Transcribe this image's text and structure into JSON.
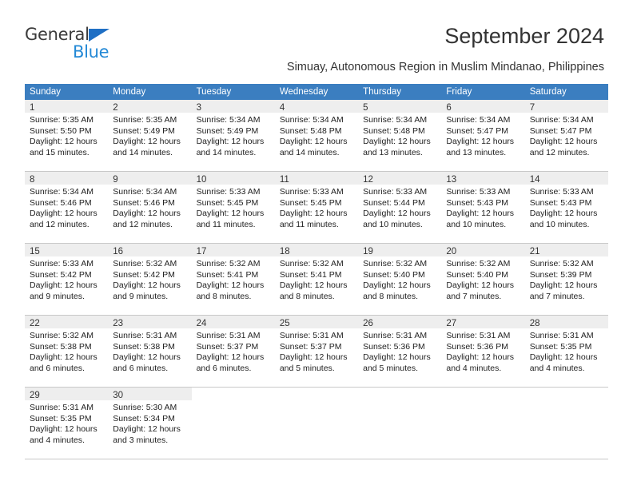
{
  "brand": {
    "name_part1": "General",
    "name_part2": "Blue",
    "accent_color": "#2489d6",
    "triangle_color": "#1f6fc4"
  },
  "header": {
    "title": "September 2024",
    "subtitle": "Simuay, Autonomous Region in Muslim Mindanao, Philippines"
  },
  "calendar": {
    "header_background": "#3b7ec0",
    "weekdays": [
      "Sunday",
      "Monday",
      "Tuesday",
      "Wednesday",
      "Thursday",
      "Friday",
      "Saturday"
    ],
    "weeks": [
      [
        {
          "day": "1",
          "sunrise": "Sunrise: 5:35 AM",
          "sunset": "Sunset: 5:50 PM",
          "daylight_line1": "Daylight: 12 hours",
          "daylight_line2": "and 15 minutes."
        },
        {
          "day": "2",
          "sunrise": "Sunrise: 5:35 AM",
          "sunset": "Sunset: 5:49 PM",
          "daylight_line1": "Daylight: 12 hours",
          "daylight_line2": "and 14 minutes."
        },
        {
          "day": "3",
          "sunrise": "Sunrise: 5:34 AM",
          "sunset": "Sunset: 5:49 PM",
          "daylight_line1": "Daylight: 12 hours",
          "daylight_line2": "and 14 minutes."
        },
        {
          "day": "4",
          "sunrise": "Sunrise: 5:34 AM",
          "sunset": "Sunset: 5:48 PM",
          "daylight_line1": "Daylight: 12 hours",
          "daylight_line2": "and 14 minutes."
        },
        {
          "day": "5",
          "sunrise": "Sunrise: 5:34 AM",
          "sunset": "Sunset: 5:48 PM",
          "daylight_line1": "Daylight: 12 hours",
          "daylight_line2": "and 13 minutes."
        },
        {
          "day": "6",
          "sunrise": "Sunrise: 5:34 AM",
          "sunset": "Sunset: 5:47 PM",
          "daylight_line1": "Daylight: 12 hours",
          "daylight_line2": "and 13 minutes."
        },
        {
          "day": "7",
          "sunrise": "Sunrise: 5:34 AM",
          "sunset": "Sunset: 5:47 PM",
          "daylight_line1": "Daylight: 12 hours",
          "daylight_line2": "and 12 minutes."
        }
      ],
      [
        {
          "day": "8",
          "sunrise": "Sunrise: 5:34 AM",
          "sunset": "Sunset: 5:46 PM",
          "daylight_line1": "Daylight: 12 hours",
          "daylight_line2": "and 12 minutes."
        },
        {
          "day": "9",
          "sunrise": "Sunrise: 5:34 AM",
          "sunset": "Sunset: 5:46 PM",
          "daylight_line1": "Daylight: 12 hours",
          "daylight_line2": "and 12 minutes."
        },
        {
          "day": "10",
          "sunrise": "Sunrise: 5:33 AM",
          "sunset": "Sunset: 5:45 PM",
          "daylight_line1": "Daylight: 12 hours",
          "daylight_line2": "and 11 minutes."
        },
        {
          "day": "11",
          "sunrise": "Sunrise: 5:33 AM",
          "sunset": "Sunset: 5:45 PM",
          "daylight_line1": "Daylight: 12 hours",
          "daylight_line2": "and 11 minutes."
        },
        {
          "day": "12",
          "sunrise": "Sunrise: 5:33 AM",
          "sunset": "Sunset: 5:44 PM",
          "daylight_line1": "Daylight: 12 hours",
          "daylight_line2": "and 10 minutes."
        },
        {
          "day": "13",
          "sunrise": "Sunrise: 5:33 AM",
          "sunset": "Sunset: 5:43 PM",
          "daylight_line1": "Daylight: 12 hours",
          "daylight_line2": "and 10 minutes."
        },
        {
          "day": "14",
          "sunrise": "Sunrise: 5:33 AM",
          "sunset": "Sunset: 5:43 PM",
          "daylight_line1": "Daylight: 12 hours",
          "daylight_line2": "and 10 minutes."
        }
      ],
      [
        {
          "day": "15",
          "sunrise": "Sunrise: 5:33 AM",
          "sunset": "Sunset: 5:42 PM",
          "daylight_line1": "Daylight: 12 hours",
          "daylight_line2": "and 9 minutes."
        },
        {
          "day": "16",
          "sunrise": "Sunrise: 5:32 AM",
          "sunset": "Sunset: 5:42 PM",
          "daylight_line1": "Daylight: 12 hours",
          "daylight_line2": "and 9 minutes."
        },
        {
          "day": "17",
          "sunrise": "Sunrise: 5:32 AM",
          "sunset": "Sunset: 5:41 PM",
          "daylight_line1": "Daylight: 12 hours",
          "daylight_line2": "and 8 minutes."
        },
        {
          "day": "18",
          "sunrise": "Sunrise: 5:32 AM",
          "sunset": "Sunset: 5:41 PM",
          "daylight_line1": "Daylight: 12 hours",
          "daylight_line2": "and 8 minutes."
        },
        {
          "day": "19",
          "sunrise": "Sunrise: 5:32 AM",
          "sunset": "Sunset: 5:40 PM",
          "daylight_line1": "Daylight: 12 hours",
          "daylight_line2": "and 8 minutes."
        },
        {
          "day": "20",
          "sunrise": "Sunrise: 5:32 AM",
          "sunset": "Sunset: 5:40 PM",
          "daylight_line1": "Daylight: 12 hours",
          "daylight_line2": "and 7 minutes."
        },
        {
          "day": "21",
          "sunrise": "Sunrise: 5:32 AM",
          "sunset": "Sunset: 5:39 PM",
          "daylight_line1": "Daylight: 12 hours",
          "daylight_line2": "and 7 minutes."
        }
      ],
      [
        {
          "day": "22",
          "sunrise": "Sunrise: 5:32 AM",
          "sunset": "Sunset: 5:38 PM",
          "daylight_line1": "Daylight: 12 hours",
          "daylight_line2": "and 6 minutes."
        },
        {
          "day": "23",
          "sunrise": "Sunrise: 5:31 AM",
          "sunset": "Sunset: 5:38 PM",
          "daylight_line1": "Daylight: 12 hours",
          "daylight_line2": "and 6 minutes."
        },
        {
          "day": "24",
          "sunrise": "Sunrise: 5:31 AM",
          "sunset": "Sunset: 5:37 PM",
          "daylight_line1": "Daylight: 12 hours",
          "daylight_line2": "and 6 minutes."
        },
        {
          "day": "25",
          "sunrise": "Sunrise: 5:31 AM",
          "sunset": "Sunset: 5:37 PM",
          "daylight_line1": "Daylight: 12 hours",
          "daylight_line2": "and 5 minutes."
        },
        {
          "day": "26",
          "sunrise": "Sunrise: 5:31 AM",
          "sunset": "Sunset: 5:36 PM",
          "daylight_line1": "Daylight: 12 hours",
          "daylight_line2": "and 5 minutes."
        },
        {
          "day": "27",
          "sunrise": "Sunrise: 5:31 AM",
          "sunset": "Sunset: 5:36 PM",
          "daylight_line1": "Daylight: 12 hours",
          "daylight_line2": "and 4 minutes."
        },
        {
          "day": "28",
          "sunrise": "Sunrise: 5:31 AM",
          "sunset": "Sunset: 5:35 PM",
          "daylight_line1": "Daylight: 12 hours",
          "daylight_line2": "and 4 minutes."
        }
      ],
      [
        {
          "day": "29",
          "sunrise": "Sunrise: 5:31 AM",
          "sunset": "Sunset: 5:35 PM",
          "daylight_line1": "Daylight: 12 hours",
          "daylight_line2": "and 4 minutes."
        },
        {
          "day": "30",
          "sunrise": "Sunrise: 5:30 AM",
          "sunset": "Sunset: 5:34 PM",
          "daylight_line1": "Daylight: 12 hours",
          "daylight_line2": "and 3 minutes."
        },
        {
          "day": "",
          "sunrise": "",
          "sunset": "",
          "daylight_line1": "",
          "daylight_line2": ""
        },
        {
          "day": "",
          "sunrise": "",
          "sunset": "",
          "daylight_line1": "",
          "daylight_line2": ""
        },
        {
          "day": "",
          "sunrise": "",
          "sunset": "",
          "daylight_line1": "",
          "daylight_line2": ""
        },
        {
          "day": "",
          "sunrise": "",
          "sunset": "",
          "daylight_line1": "",
          "daylight_line2": ""
        },
        {
          "day": "",
          "sunrise": "",
          "sunset": "",
          "daylight_line1": "",
          "daylight_line2": ""
        }
      ]
    ]
  }
}
